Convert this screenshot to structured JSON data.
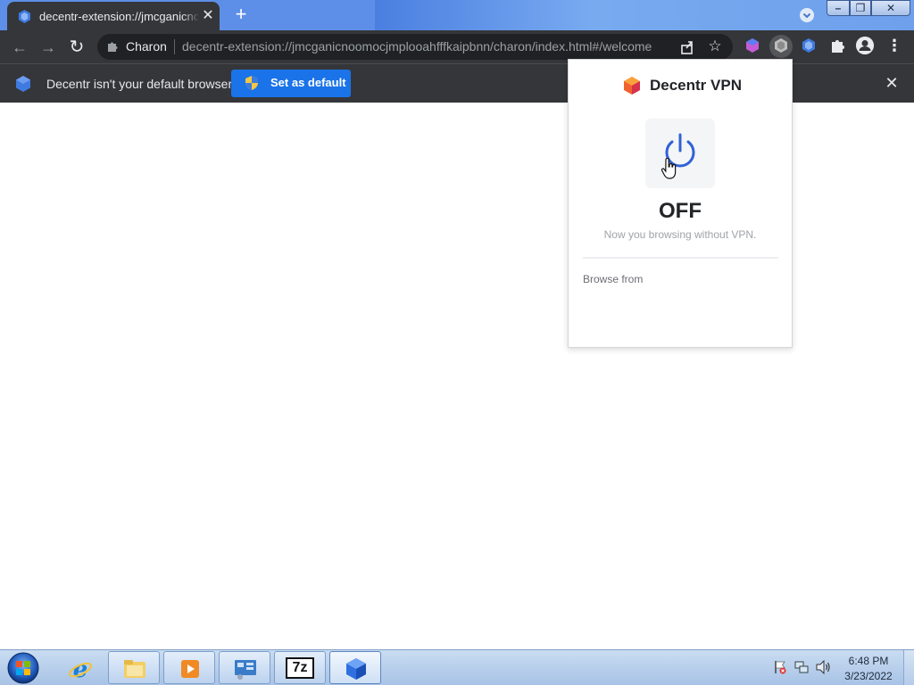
{
  "browser": {
    "tab": {
      "title": "decentr-extension://jmcganicnoomocjmplooahfffkaipbnn/charon/index.html#/welcome",
      "close_glyph": "✕"
    },
    "new_tab_glyph": "+",
    "window_controls": {
      "minimize": "–",
      "maximize": "❐",
      "close": "✕"
    },
    "toolbar": {
      "back_glyph": "←",
      "forward_glyph": "→",
      "reload_glyph": "↻",
      "site_chip": "Charon",
      "url": "decentr-extension://jmcganicnoomocjmplooahfffkaipbnn/charon/index.html#/welcome",
      "star_glyph": "☆",
      "menu_glyph": "⋮"
    },
    "icons": [
      "puzzle-icon",
      "share-icon",
      "star-icon",
      "decentr-extension-icon",
      "vpn-extension-icon",
      "extensions-puzzle-icon",
      "profile-icon"
    ]
  },
  "infobar": {
    "message": "Decentr isn't your default browser",
    "button_label": "Set as default",
    "close_glyph": "✕"
  },
  "vpn_popup": {
    "title": "Decentr VPN",
    "state": "OFF",
    "subtitle": "Now you browsing without VPN.",
    "browse_from_label": "Browse from"
  },
  "taskbar": {
    "items": [
      "internet-explorer",
      "windows-explorer",
      "media-player",
      "network-tool",
      "7-zip",
      "decentr-browser"
    ],
    "seven_zip_label": "7z",
    "clock": {
      "time": "6:48 PM",
      "date": "3/23/2022"
    }
  },
  "colors": {
    "accent_blue": "#1a73e8",
    "chrome_dark": "#35363a",
    "omnibox": "#202124",
    "power_blue": "#2f62d6"
  }
}
